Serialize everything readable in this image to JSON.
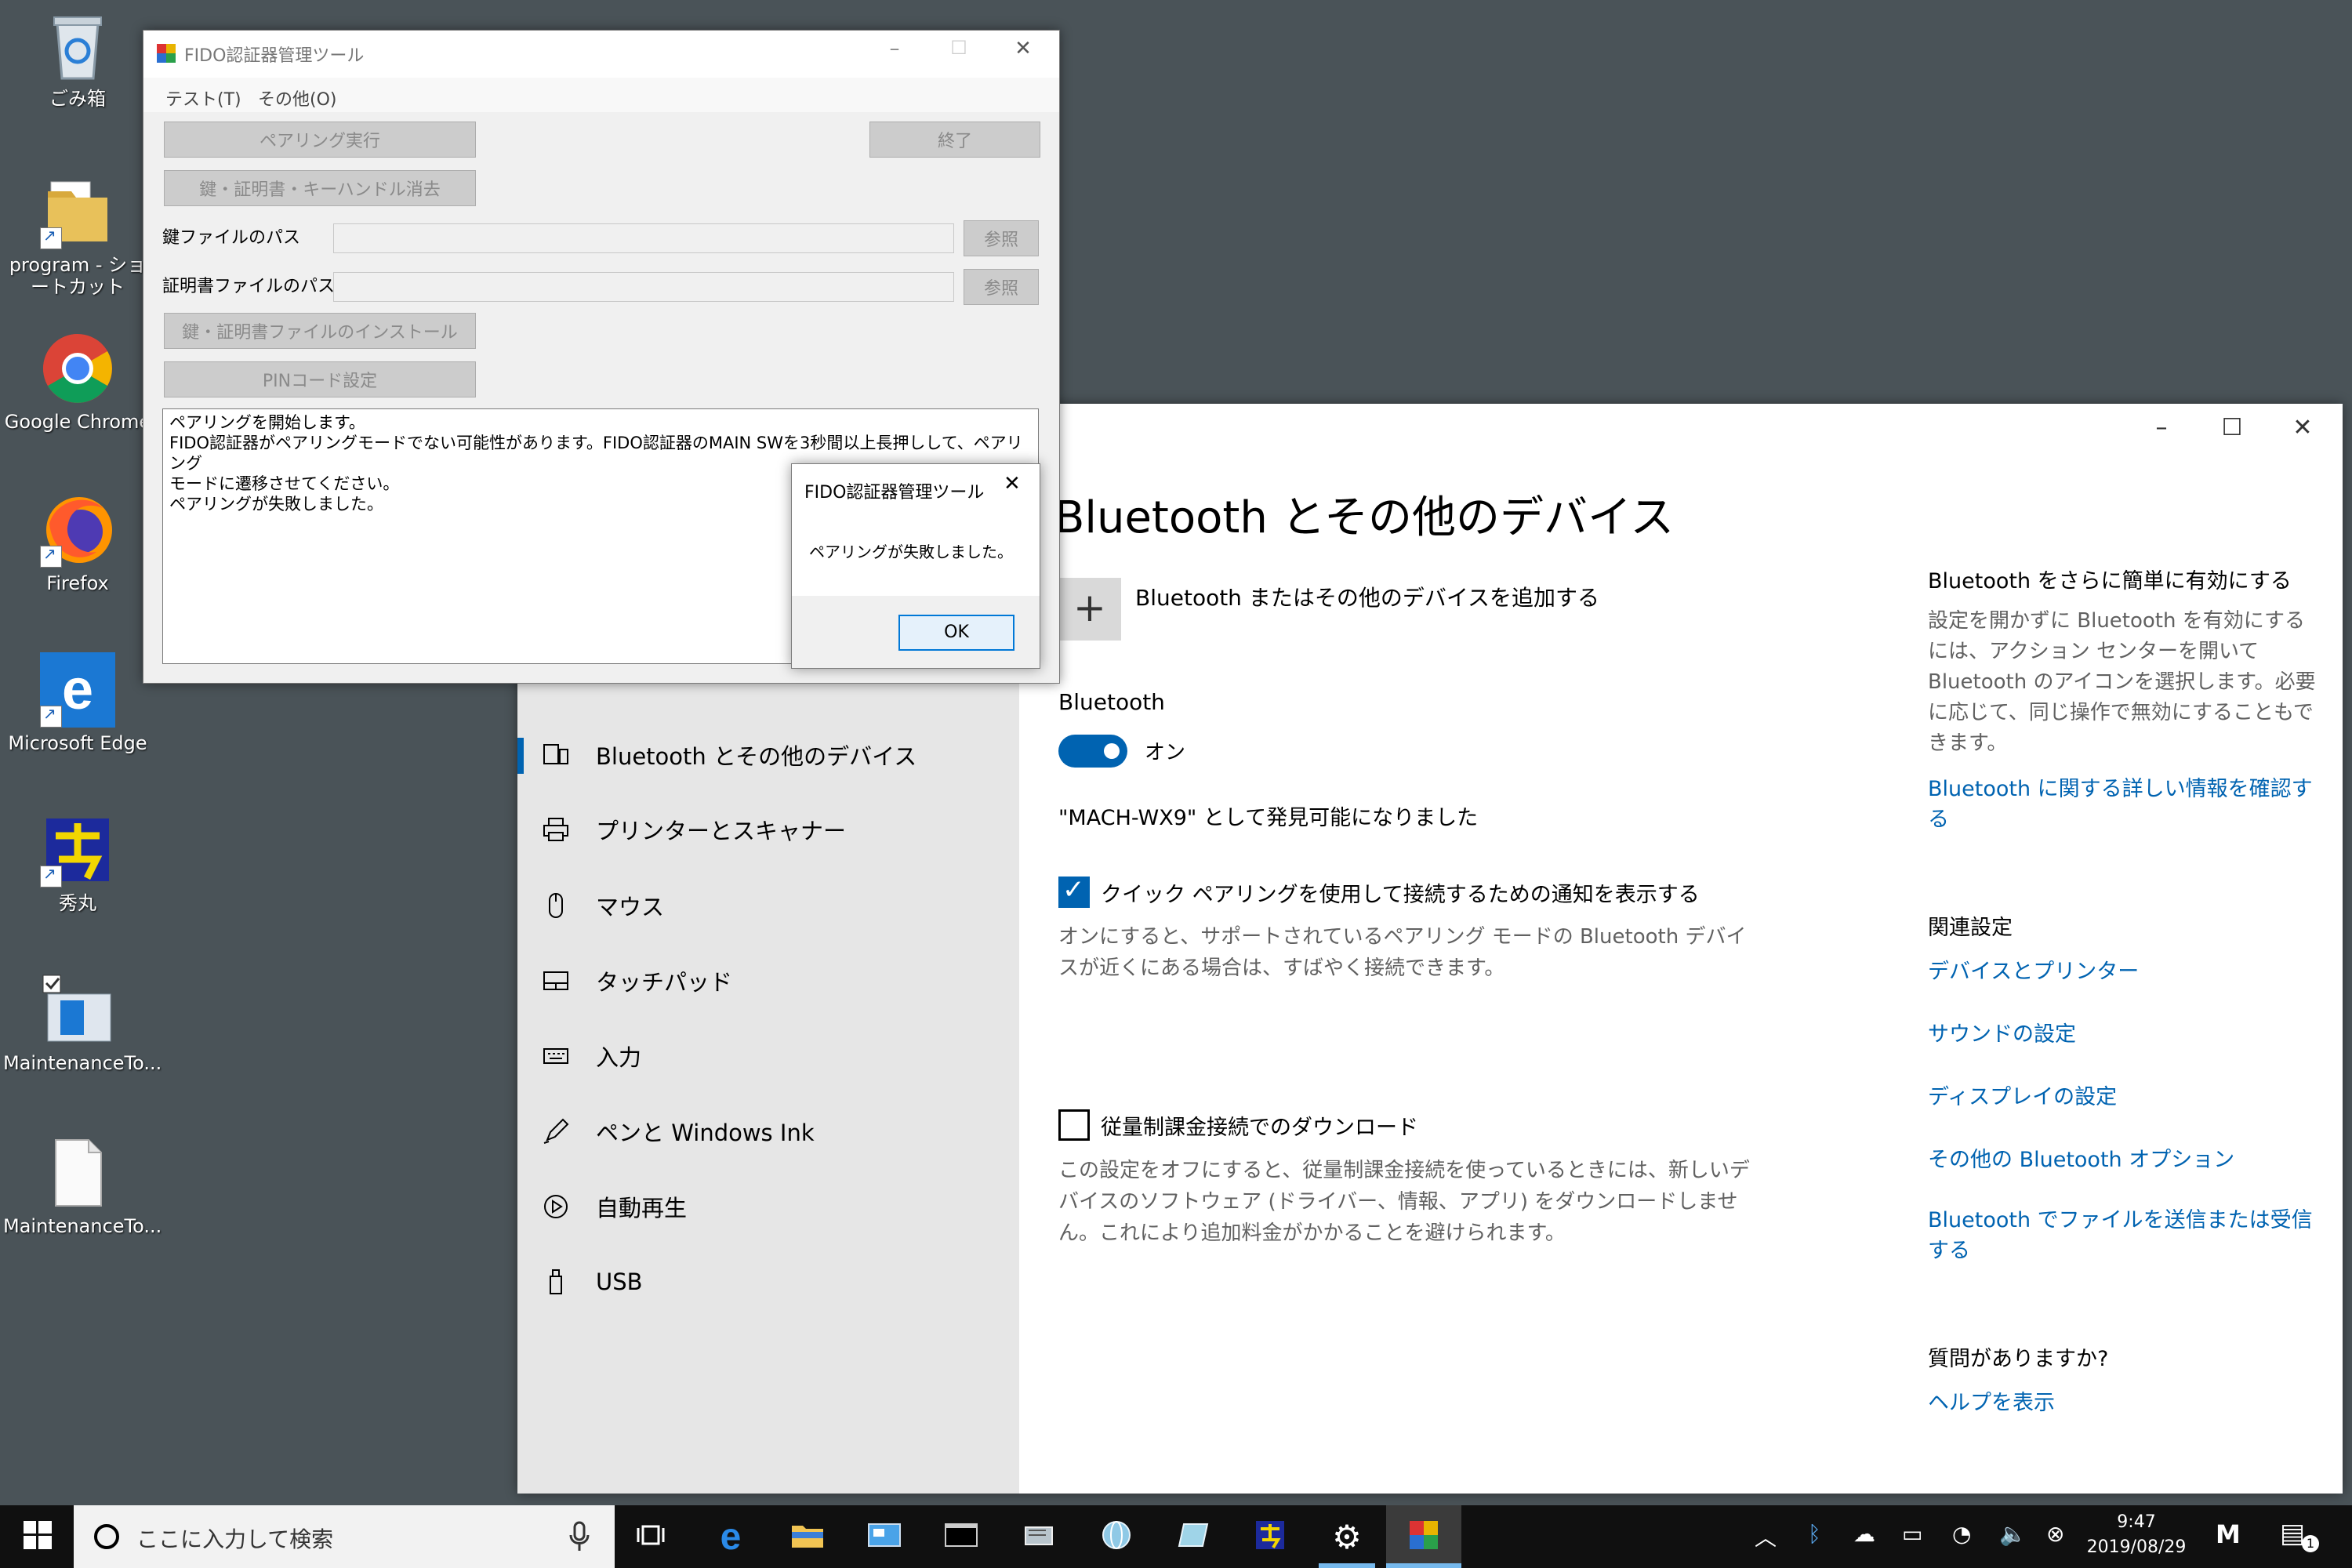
{
  "desktop": {
    "icons": [
      {
        "label": "ごみ箱",
        "icon": "recycle-bin-icon"
      },
      {
        "label": "program - ショートカット",
        "icon": "folder-icon"
      },
      {
        "label": "Google Chrome",
        "icon": "chrome-icon"
      },
      {
        "label": "Firefox",
        "icon": "firefox-icon"
      },
      {
        "label": "Microsoft Edge",
        "icon": "edge-icon"
      },
      {
        "label": "秀丸",
        "icon": "hidemaru-icon"
      },
      {
        "label": "MaintenanceTo...",
        "icon": "maintenance-tool-app-icon"
      },
      {
        "label": "MaintenanceTo...",
        "icon": "document-icon"
      }
    ]
  },
  "fido_window": {
    "title": "FIDO認証器管理ツール",
    "menu": [
      "テスト(T)",
      "その他(O)"
    ],
    "buttons": {
      "pairing": "ペアリング実行",
      "exit": "終了",
      "erase": "鍵・証明書・キーハンドル消去",
      "browse_key": "参照",
      "browse_cert": "参照",
      "install": "鍵・証明書ファイルのインストール",
      "pin": "PINコード設定"
    },
    "labels": {
      "key_path": "鍵ファイルのパス",
      "cert_path": "証明書ファイルのパス"
    },
    "log": "ペアリングを開始します。\nFIDO認証器がペアリングモードでない可能性があります。FIDO認証器のMAIN SWを3秒間以上長押しして、ペアリング\nモードに遷移させてください。\nペアリングが失敗しました。"
  },
  "message_box": {
    "title": "FIDO認証器管理ツール",
    "message": "ペアリングが失敗しました。",
    "ok": "OK"
  },
  "settings": {
    "nav": [
      {
        "label": "Bluetooth とその他のデバイス",
        "icon": "devices-icon",
        "active": true
      },
      {
        "label": "プリンターとスキャナー",
        "icon": "printer-icon",
        "active": false
      },
      {
        "label": "マウス",
        "icon": "mouse-icon",
        "active": false
      },
      {
        "label": "タッチパッド",
        "icon": "touchpad-icon",
        "active": false
      },
      {
        "label": "入力",
        "icon": "keyboard-icon",
        "active": false
      },
      {
        "label": "ペンと Windows Ink",
        "icon": "pen-icon",
        "active": false
      },
      {
        "label": "自動再生",
        "icon": "autoplay-icon",
        "active": false
      },
      {
        "label": "USB",
        "icon": "usb-icon",
        "active": false
      }
    ],
    "heading": "Bluetooth とその他のデバイス",
    "add_device": "Bluetooth またはその他のデバイスを追加する",
    "bluetooth_label": "Bluetooth",
    "toggle_state": "オン",
    "discoverable": "\"MACH-WX9\" として発見可能になりました",
    "quick_pair_label": "クイック ペアリングを使用して接続するための通知を表示する",
    "quick_pair_desc": "オンにすると、サポートされているペアリング モードの Bluetooth デバイスが近くにある場合は、すばやく接続できます。",
    "metered_label": "従量制課金接続でのダウンロード",
    "metered_desc": "この設定をオフにすると、従量制課金接続を使っているときには、新しいデバイスのソフトウェア (ドライバー、情報、アプリ) をダウンロードしません。これにより追加料金がかかることを避けられます。",
    "side": {
      "heading": "Bluetooth をさらに簡単に有効にする",
      "desc": "設定を開かずに Bluetooth を有効にするには、アクション センターを開いて Bluetooth のアイコンを選択します。必要に応じて、同じ操作で無効にすることもできます。",
      "learn_more": "Bluetooth に関する詳しい情報を確認する",
      "related_heading": "関連設定",
      "related_links": [
        "デバイスとプリンター",
        "サウンドの設定",
        "ディスプレイの設定",
        "その他の Bluetooth オプション",
        "Bluetooth でファイルを送信または受信する"
      ],
      "question_heading": "質問がありますか?",
      "help_link": "ヘルプを表示"
    }
  },
  "taskbar": {
    "search_placeholder": "ここに入力して検索",
    "time": "9:47",
    "date": "2019/08/29",
    "ime": "M",
    "notification_count": "1"
  },
  "colors": {
    "accent": "#0063b1",
    "desktop": "#4a5358",
    "taskbar": "#101010"
  }
}
